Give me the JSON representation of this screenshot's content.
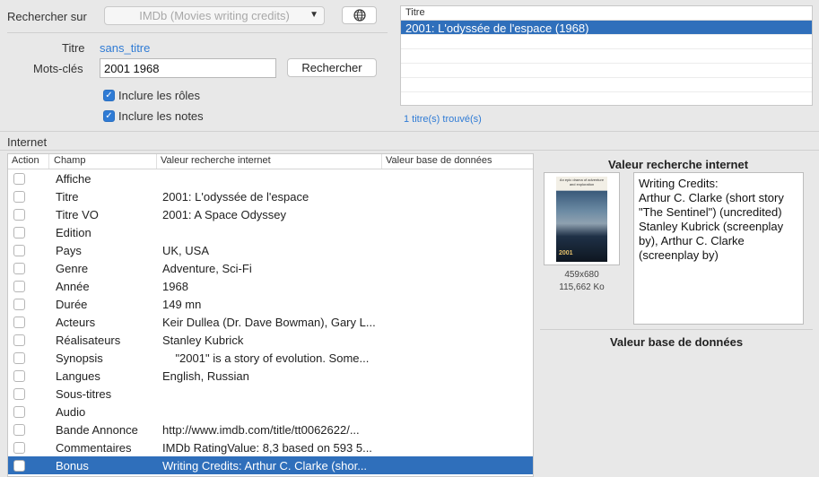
{
  "search": {
    "label": "Rechercher sur",
    "source": "IMDb (Movies writing credits)",
    "title_label": "Titre",
    "title_value": "sans_titre",
    "keywords_label": "Mots-clés",
    "keywords_value": "2001 1968",
    "search_button": "Rechercher",
    "include_roles": "Inclure les rôles",
    "include_notes": "Inclure les notes"
  },
  "results": {
    "header": "Titre",
    "rows": [
      "2001: L'odyssée de l'espace (1968)"
    ],
    "found": "1 titre(s) trouvé(s)"
  },
  "internet": {
    "label": "Internet",
    "columns": [
      "Action",
      "Champ",
      "Valeur recherche internet",
      "Valeur base de données"
    ],
    "rows": [
      {
        "field": "Affiche",
        "value": ""
      },
      {
        "field": "Titre",
        "value": "2001: L'odyssée de l'espace"
      },
      {
        "field": "Titre VO",
        "value": "2001: A Space Odyssey"
      },
      {
        "field": "Edition",
        "value": ""
      },
      {
        "field": "Pays",
        "value": "UK, USA"
      },
      {
        "field": "Genre",
        "value": "Adventure, Sci-Fi"
      },
      {
        "field": "Année",
        "value": "1968"
      },
      {
        "field": "Durée",
        "value": "149 mn"
      },
      {
        "field": "Acteurs",
        "value": "Keir Dullea (Dr. Dave Bowman), Gary L..."
      },
      {
        "field": "Réalisateurs",
        "value": "Stanley Kubrick"
      },
      {
        "field": "Synopsis",
        "value": "    \"2001\" is a story of evolution. Some..."
      },
      {
        "field": "Langues",
        "value": "English, Russian"
      },
      {
        "field": "Sous-titres",
        "value": ""
      },
      {
        "field": "Audio",
        "value": ""
      },
      {
        "field": "Bande Annonce",
        "value": "http://www.imdb.com/title/tt0062622/..."
      },
      {
        "field": "Commentaires",
        "value": "IMDb RatingValue: 8,3 based on 593 5..."
      },
      {
        "field": "Bonus",
        "value": "Writing Credits: Arthur C. Clarke (shor..."
      }
    ]
  },
  "preview": {
    "internet_title": "Valeur recherche internet",
    "poster_caption": "An epic drama of adventure and exploration",
    "poster_title": "2001",
    "image_size": "459x680",
    "image_weight": "115,662 Ko",
    "text": "Writing Credits:\nArthur C. Clarke (short story \"The Sentinel\") (uncredited)\nStanley Kubrick (screenplay by), Arthur C. Clarke (screenplay by)",
    "db_title": "Valeur base de données"
  },
  "colors": {
    "accent": "#2f7bd5",
    "selection": "#2f6fbb"
  }
}
